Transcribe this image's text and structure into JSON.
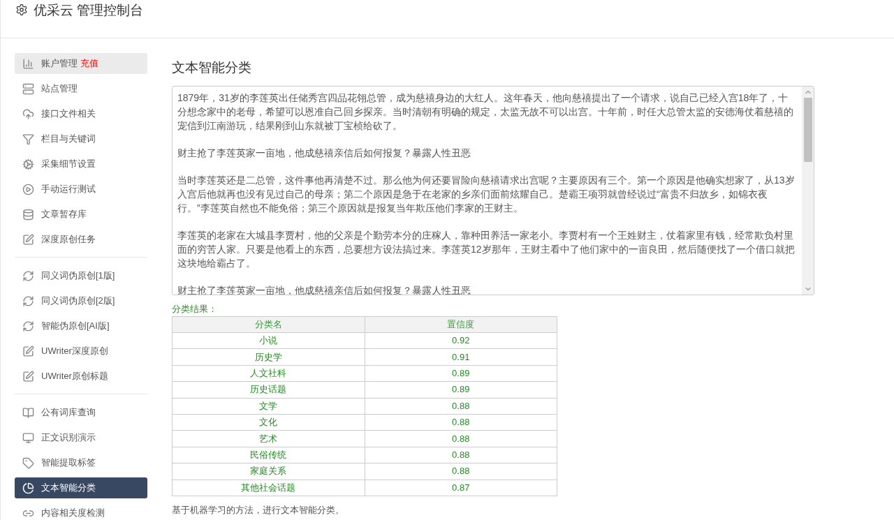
{
  "header": {
    "title": "优采云 管理控制台"
  },
  "sidebar": {
    "sections": [
      {
        "items": [
          {
            "label": "账户管理",
            "badge": "充值",
            "selected": false,
            "highlighted": true
          },
          {
            "label": "站点管理",
            "selected": false,
            "highlighted": false
          },
          {
            "label": "接口文件相关",
            "selected": false,
            "highlighted": false
          },
          {
            "label": "栏目与关键词",
            "selected": false,
            "highlighted": false
          },
          {
            "label": "采集细节设置",
            "selected": false,
            "highlighted": false
          },
          {
            "label": "手动运行测试",
            "selected": false,
            "highlighted": false
          },
          {
            "label": "文章暂存库",
            "selected": false,
            "highlighted": false
          },
          {
            "label": "深度原创任务",
            "selected": false,
            "highlighted": false
          }
        ]
      },
      {
        "items": [
          {
            "label": "同义词伪原创[1版]",
            "selected": false,
            "highlighted": false
          },
          {
            "label": "同义词伪原创[2版]",
            "selected": false,
            "highlighted": false
          },
          {
            "label": "智能伪原创[AI版]",
            "selected": false,
            "highlighted": false
          },
          {
            "label": "UWriter深度原创",
            "selected": false,
            "highlighted": false
          },
          {
            "label": "UWriter原创标题",
            "selected": false,
            "highlighted": false
          }
        ]
      },
      {
        "items": [
          {
            "label": "公有词库查询",
            "selected": false,
            "highlighted": false
          },
          {
            "label": "正文识别演示",
            "selected": false,
            "highlighted": false
          },
          {
            "label": "智能提取标签",
            "selected": false,
            "highlighted": false
          },
          {
            "label": "文本智能分类",
            "selected": true,
            "highlighted": false
          },
          {
            "label": "内容相关度检测",
            "selected": false,
            "highlighted": false
          }
        ]
      }
    ]
  },
  "main": {
    "title": "文本智能分类",
    "input_text": [
      "1879年，31岁的李莲英出任储秀宫四品花翎总管，成为慈禧身边的大红人。这年春天，他向慈禧提出了一个请求，说自己已经入宫18年了，十分想念家中的老母，希望可以恩准自己回乡探亲。当时清朝有明确的规定，太监无故不可以出宫。十年前，时任大总管太监的安德海仗着慈禧的宠信到江南游玩，结果刚到山东就被丁宝桢给砍了。",
      "财主抢了李莲英家一亩地，他成慈禧亲信后如何报复？暴露人性丑恶",
      "当时李莲英还是二总管，这件事他再清楚不过。那么他为何还要冒险向慈禧请求出宫呢？主要原因有三个。第一个原因是他确实想家了，从13岁入宫后他就再也没有见过自己的母亲；第二个原因是急于在老家的乡亲们面前炫耀自己。楚霸王项羽就曾经说过“富贵不归故乡，如锦衣夜行。”李莲英自然也不能免俗；第三个原因就是报复当年欺压他们李家的王财主。",
      "李莲英的老家在大城县李贾村，他的父亲是个勤劳本分的庄稼人，靠种田养活一家老小。李贾村有一个王姓财主，仗着家里有钱，经常欺负村里面的穷苦人家。只要是他看上的东西，总要想方设法搞过来。李莲英12岁那年，王财主看中了他们家中的一亩良田，然后随便找了一个借口就把这块地给霸占了。",
      "财主抢了李莲英家一亩地，他成慈禧亲信后如何报复？暴露人性丑恶"
    ],
    "result_label": "分类结果：",
    "table": {
      "columns": [
        "分类名",
        "置信度"
      ],
      "rows": [
        [
          "小说",
          "0.92"
        ],
        [
          "历史学",
          "0.91"
        ],
        [
          "人文社科",
          "0.89"
        ],
        [
          "历史话题",
          "0.89"
        ],
        [
          "文学",
          "0.88"
        ],
        [
          "文化",
          "0.88"
        ],
        [
          "艺术",
          "0.88"
        ],
        [
          "民俗传统",
          "0.88"
        ],
        [
          "家庭关系",
          "0.88"
        ],
        [
          "其他社会话题",
          "0.87"
        ]
      ]
    },
    "note": "基于机器学习的方法，进行文本智能分类。"
  }
}
